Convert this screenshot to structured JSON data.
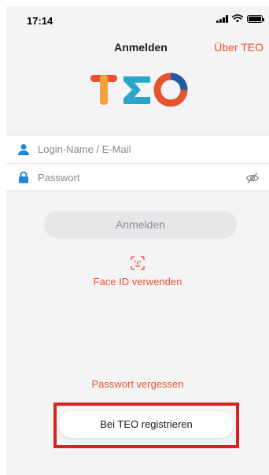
{
  "status_bar": {
    "time": "17:14"
  },
  "nav": {
    "title": "Anmelden",
    "right_link": "Über TEO"
  },
  "logo": {
    "text": "TEO",
    "colors": [
      "#f0512f",
      "#2aa6c8",
      "#e5532d"
    ]
  },
  "form": {
    "username_placeholder": "Login-Name / E-Mail",
    "password_placeholder": "Passwort"
  },
  "login_button": "Anmelden",
  "face_id_label": "Face ID verwenden",
  "forgot_password": "Passwort vergessen",
  "register_button": "Bei TEO registrieren",
  "colors": {
    "accent": "#e5532d",
    "field_icon": "#1e88d6",
    "highlight": "#d9221c"
  },
  "icons": [
    "person-icon",
    "lock-icon",
    "eye-slash-icon",
    "face-id-icon"
  ]
}
